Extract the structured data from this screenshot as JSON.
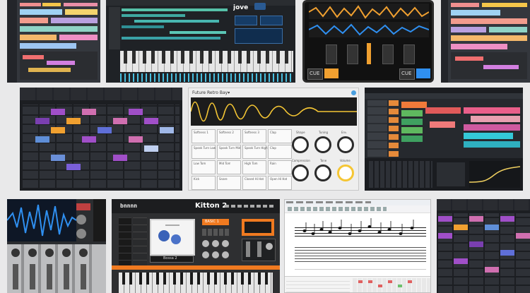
{
  "jove_window": {
    "brand": "jove"
  },
  "deck_window": {
    "cue_left": "CUE",
    "cue_right": "CUE"
  },
  "synth_window": {
    "title": "Future Retro Bay▾",
    "pads": [
      [
        "Softness 1",
        "Softness 2",
        "Softness 3",
        "Clap"
      ],
      [
        "Spook Turn Low",
        "Spook Turn Mid",
        "Spook Turn High",
        "Clap"
      ],
      [
        "Low Tom",
        "Mid Tom",
        "High Tom",
        "Rain"
      ],
      [
        "Kick",
        "Snare",
        "Closed Hi Hat",
        "Open Hi Hat"
      ]
    ],
    "knob_labels": [
      [
        "Shape",
        "Tuning",
        "Env"
      ],
      [
        "Compression",
        "Tone",
        "Volume"
      ]
    ]
  },
  "kitton_window": {
    "brand": "bnnnn",
    "title": "Kitton 2",
    "kit_name": "Bossa 2",
    "preset": "BASIC 1"
  },
  "colors": {
    "accent_orange": "#f0a030",
    "accent_blue": "#2f8ff0",
    "accent_cyan": "#34c8d8",
    "clip_purple": "#a04fc8",
    "clip_pink": "#d06fb0",
    "clip_green": "#5fb85f",
    "daw_bg": "#2a2d33"
  }
}
